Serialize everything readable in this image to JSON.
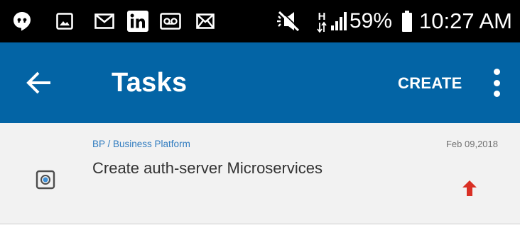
{
  "status_bar": {
    "icons": [
      "hangouts-icon",
      "gallery-icon",
      "gmail-icon",
      "linkedin-icon",
      "voicemail-icon",
      "email-icon",
      "mute-icon",
      "network-h-icon",
      "signal-icon",
      "battery-icon"
    ],
    "battery": "59%",
    "time": "10:27 AM"
  },
  "app_bar": {
    "title": "Tasks",
    "create_label": "CREATE",
    "color": "#0364A5"
  },
  "task": {
    "project": "BP / Business Platform",
    "title": "Create auth-server Microservices",
    "date": "Feb 09,2018",
    "priority_color": "#d93025"
  }
}
